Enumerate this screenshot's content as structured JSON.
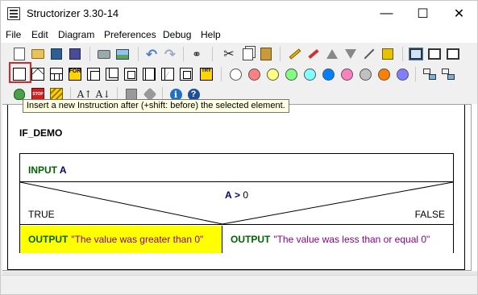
{
  "window": {
    "title": "Structorizer 3.30-14",
    "minimize": "—",
    "maximize": "☐",
    "close": "✕"
  },
  "menu": {
    "items": [
      "File",
      "Edit",
      "Diagram",
      "Preferences",
      "Debug",
      "Help"
    ]
  },
  "toolbar": {
    "element_colors": [
      "#ffffff",
      "#ff8080",
      "#ffff80",
      "#80ff80",
      "#80ffff",
      "#0080ff",
      "#ff80c0",
      "#c0c0c0",
      "#ff8000",
      "#8080ff"
    ],
    "for_label": "FOR",
    "try_label": "TRY",
    "stop_label": "STOP",
    "font_up": "A↑",
    "font_down": "A↓",
    "info_glyph": "i",
    "help_glyph": "?"
  },
  "tooltip": "Insert a new Instruction after (+shift: before) the selected element.",
  "diagram": {
    "name": "IF_DEMO",
    "input": {
      "keyword": "INPUT",
      "variable": "A"
    },
    "condition": {
      "variable": "A",
      "operator": ">",
      "value": "0"
    },
    "true_label": "TRUE",
    "false_label": "FALSE",
    "true_branch": {
      "keyword": "OUTPUT",
      "text": "\"The value was greater than 0\"",
      "color": "#ffff00"
    },
    "false_branch": {
      "keyword": "OUTPUT",
      "text": "\"The value was less than or equal 0\"",
      "color": "#ffffff"
    }
  }
}
